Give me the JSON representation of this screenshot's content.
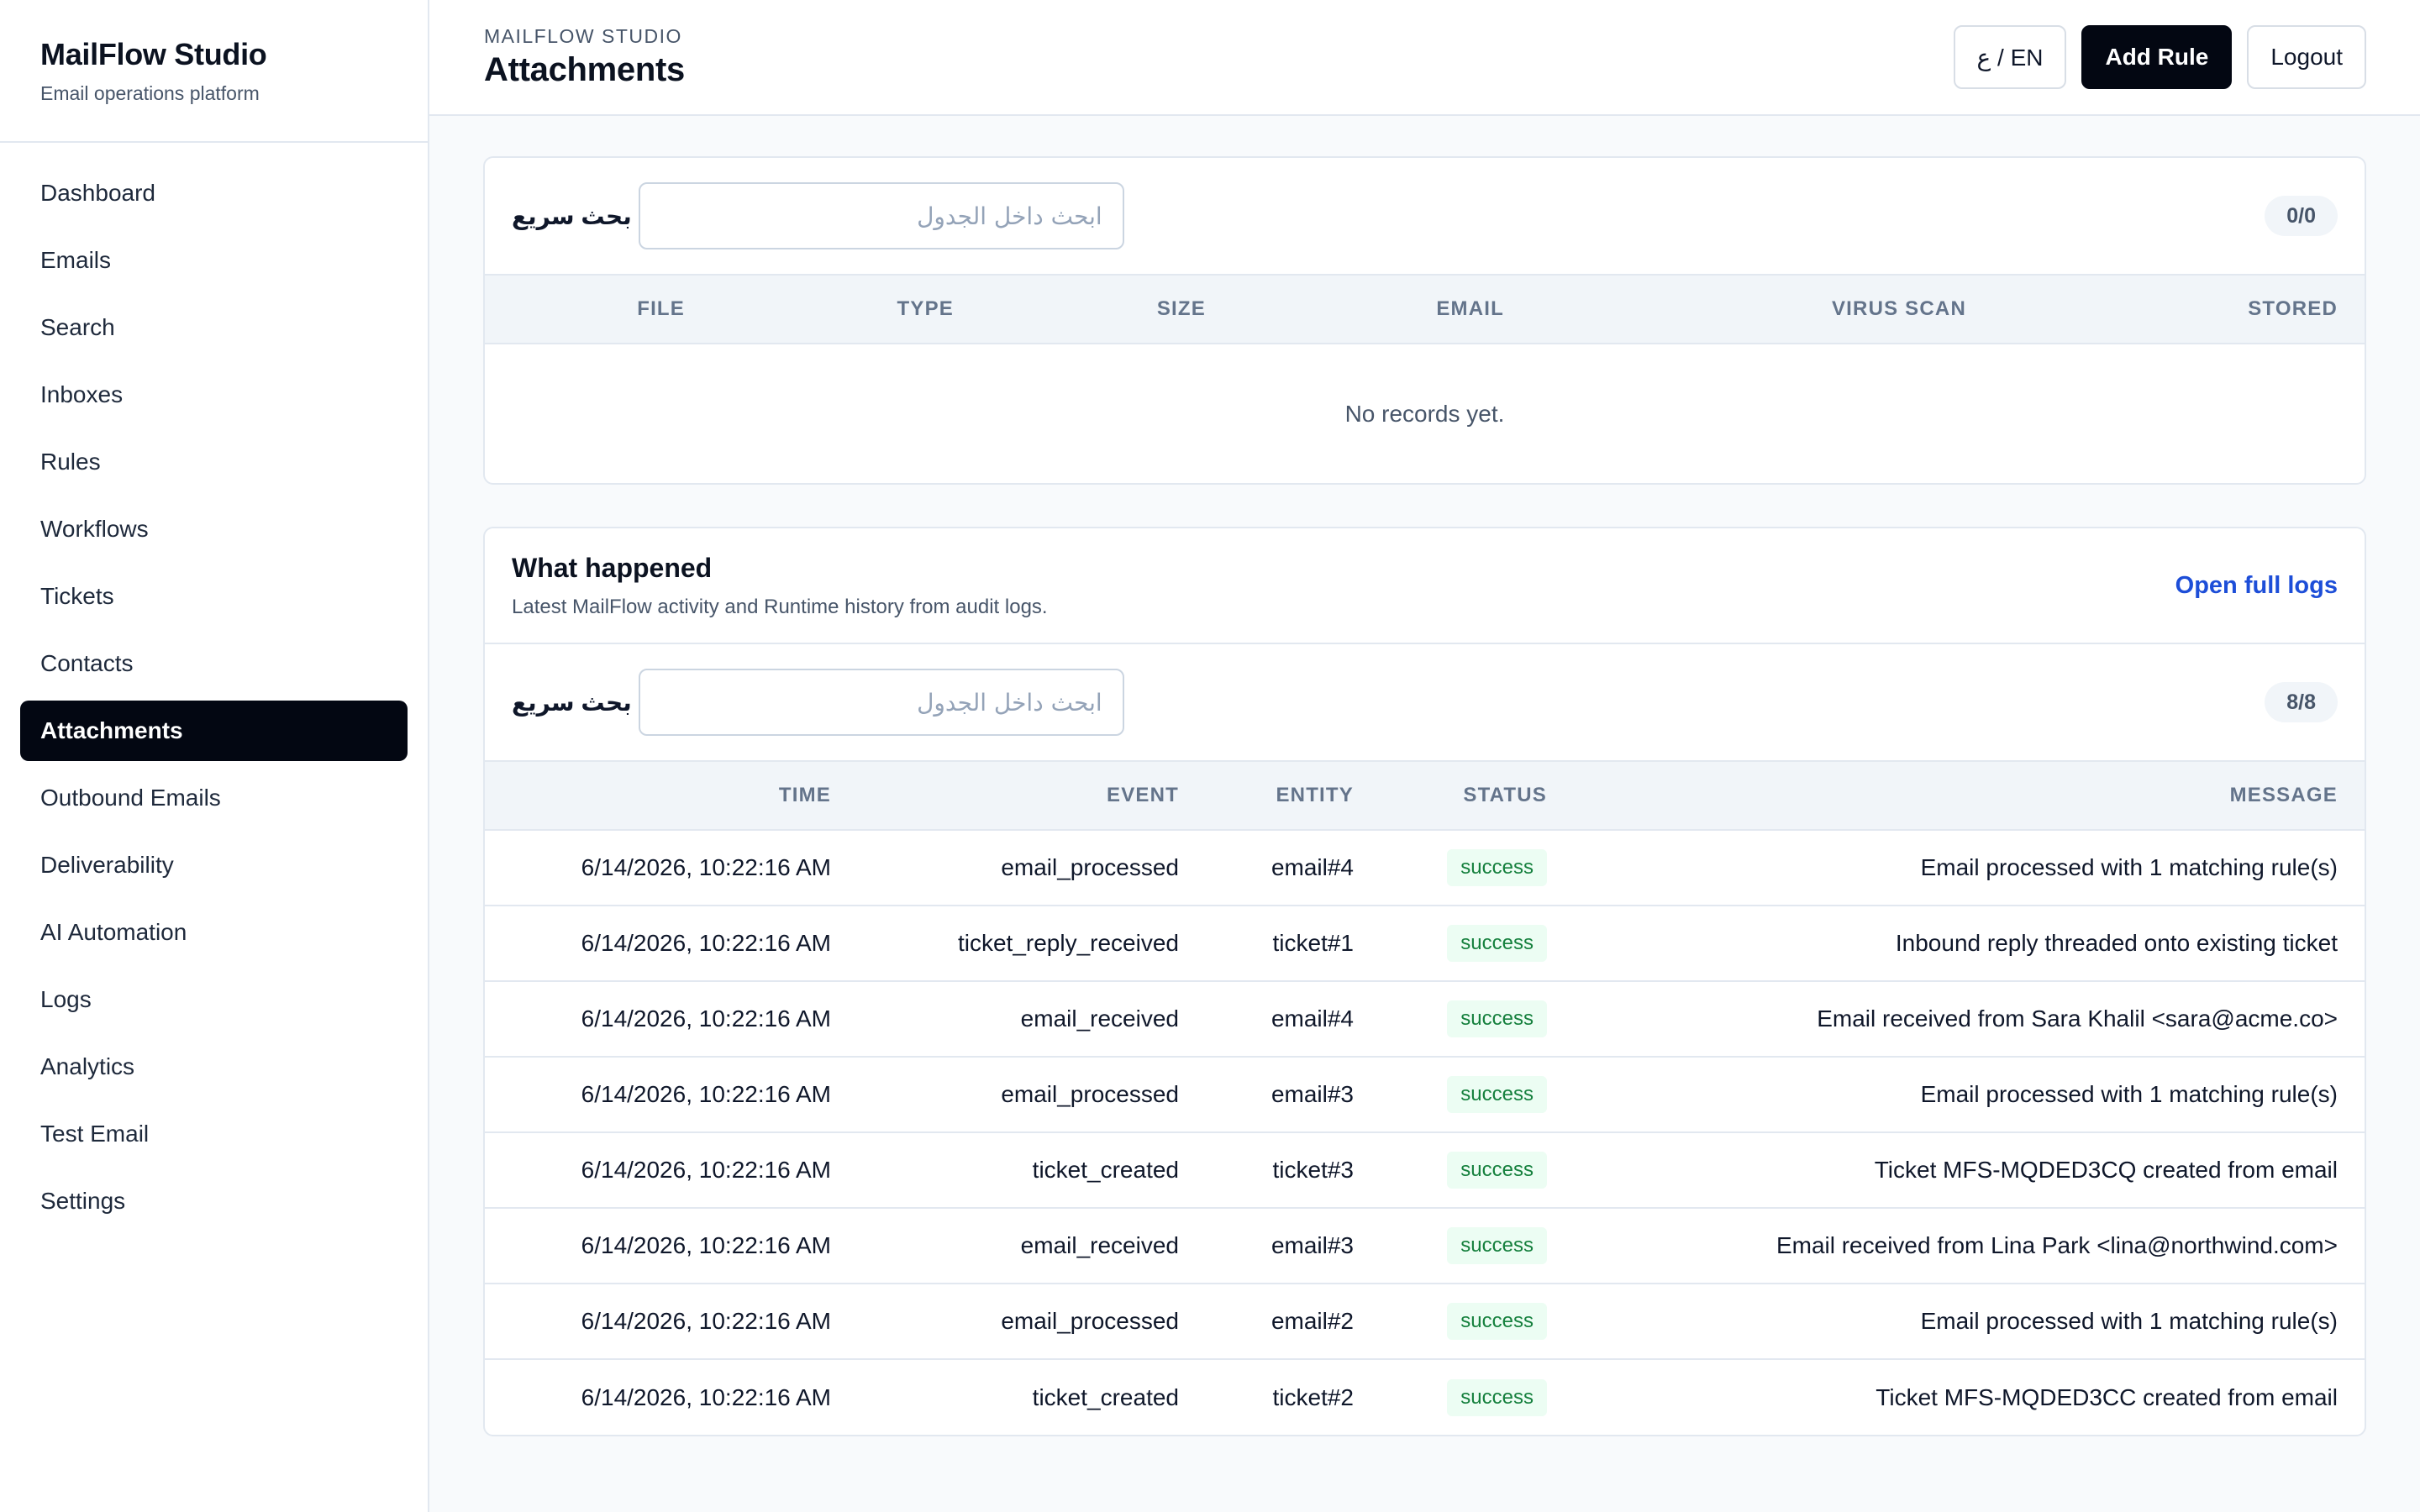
{
  "sidebar": {
    "brand_title": "MailFlow Studio",
    "brand_sub": "Email operations platform",
    "items": [
      {
        "label": "Dashboard"
      },
      {
        "label": "Emails"
      },
      {
        "label": "Search"
      },
      {
        "label": "Inboxes"
      },
      {
        "label": "Rules"
      },
      {
        "label": "Workflows"
      },
      {
        "label": "Tickets"
      },
      {
        "label": "Contacts"
      },
      {
        "label": "Attachments",
        "active": true
      },
      {
        "label": "Outbound Emails"
      },
      {
        "label": "Deliverability"
      },
      {
        "label": "AI Automation"
      },
      {
        "label": "Logs"
      },
      {
        "label": "Analytics"
      },
      {
        "label": "Test Email"
      },
      {
        "label": "Settings"
      }
    ]
  },
  "header": {
    "eyebrow": "MAILFLOW STUDIO",
    "title": "Attachments",
    "lang_toggle": "ع / EN",
    "add_rule": "Add Rule",
    "logout": "Logout"
  },
  "attachments": {
    "search_label": "بحث سريع",
    "search_placeholder": "ابحث داخل الجدول",
    "count": "0/0",
    "columns": [
      "FILE",
      "TYPE",
      "SIZE",
      "EMAIL",
      "VIRUS SCAN",
      "STORED"
    ],
    "empty": "No records yet."
  },
  "activity": {
    "title": "What happened",
    "subtitle": "Latest MailFlow activity and Runtime history from audit logs.",
    "open_logs": "Open full logs",
    "search_label": "بحث سريع",
    "search_placeholder": "ابحث داخل الجدول",
    "count": "8/8",
    "columns": [
      "TIME",
      "EVENT",
      "ENTITY",
      "STATUS",
      "MESSAGE"
    ],
    "rows": [
      {
        "time": "6/14/2026, 10:22:16 AM",
        "event": "email_processed",
        "entity": "email#4",
        "status": "success",
        "message": "Email processed with 1 matching rule(s)"
      },
      {
        "time": "6/14/2026, 10:22:16 AM",
        "event": "ticket_reply_received",
        "entity": "ticket#1",
        "status": "success",
        "message": "Inbound reply threaded onto existing ticket"
      },
      {
        "time": "6/14/2026, 10:22:16 AM",
        "event": "email_received",
        "entity": "email#4",
        "status": "success",
        "message": "Email received from Sara Khalil <sara@acme.co>"
      },
      {
        "time": "6/14/2026, 10:22:16 AM",
        "event": "email_processed",
        "entity": "email#3",
        "status": "success",
        "message": "Email processed with 1 matching rule(s)"
      },
      {
        "time": "6/14/2026, 10:22:16 AM",
        "event": "ticket_created",
        "entity": "ticket#3",
        "status": "success",
        "message": "Ticket MFS-MQDED3CQ created from email"
      },
      {
        "time": "6/14/2026, 10:22:16 AM",
        "event": "email_received",
        "entity": "email#3",
        "status": "success",
        "message": "Email received from Lina Park <lina@northwind.com>"
      },
      {
        "time": "6/14/2026, 10:22:16 AM",
        "event": "email_processed",
        "entity": "email#2",
        "status": "success",
        "message": "Email processed with 1 matching rule(s)"
      },
      {
        "time": "6/14/2026, 10:22:16 AM",
        "event": "ticket_created",
        "entity": "ticket#2",
        "status": "success",
        "message": "Ticket MFS-MQDED3CC created from email"
      }
    ]
  },
  "colors": {
    "accent_dark": "#030712",
    "link": "#1d4ed8",
    "success_text": "#15803d",
    "success_bg": "#ecfdf3"
  }
}
